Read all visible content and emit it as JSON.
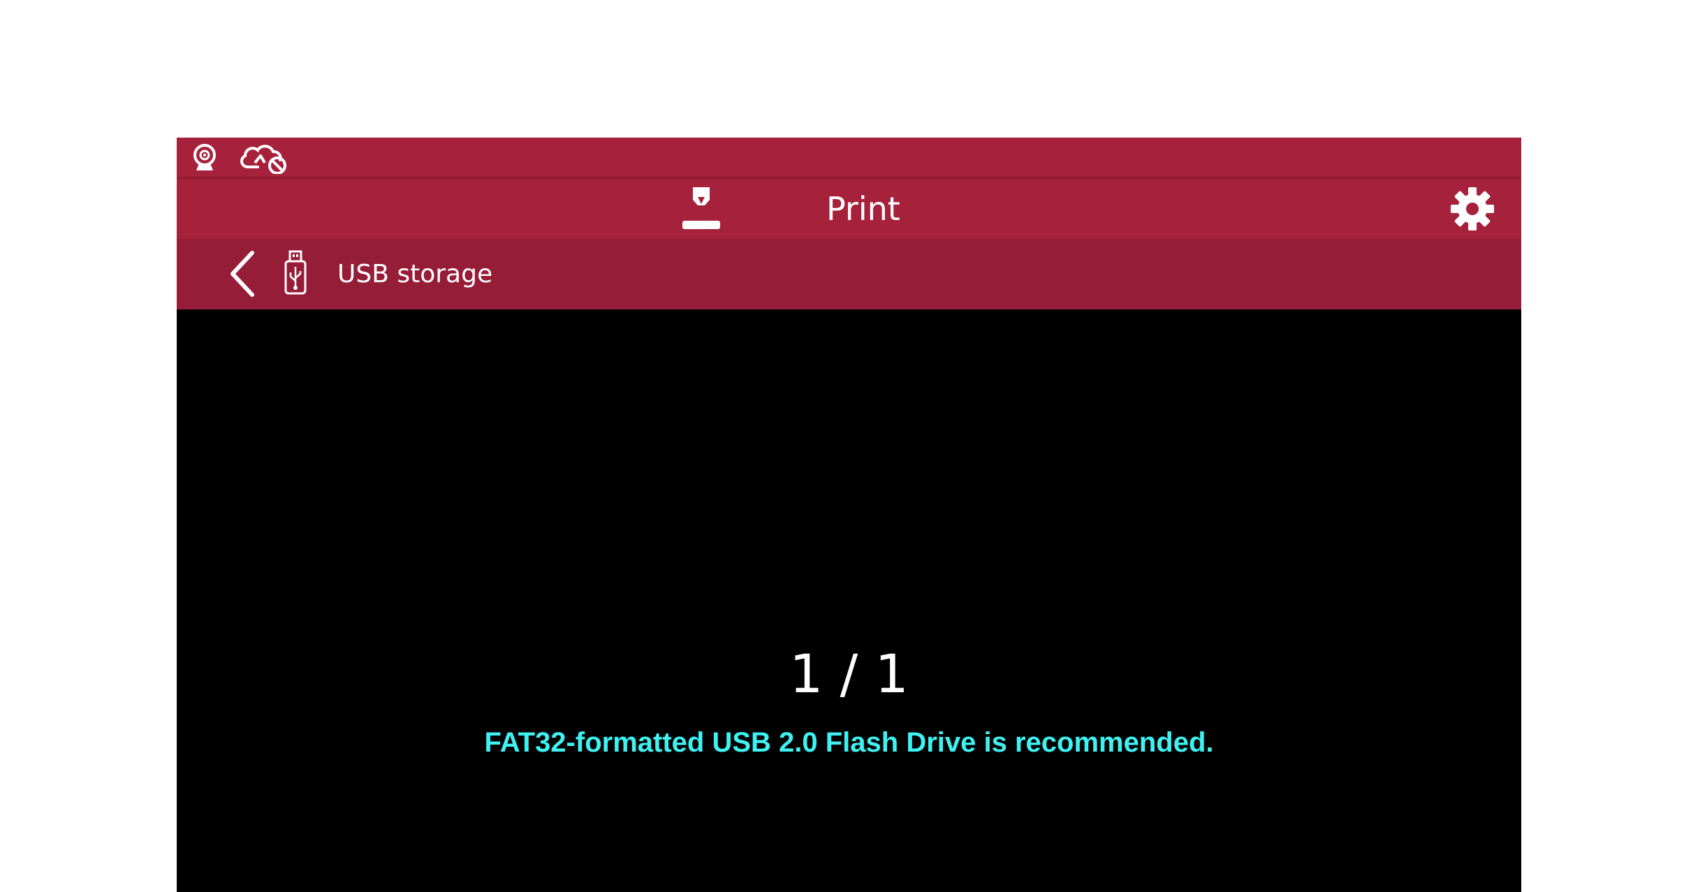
{
  "status_bar": {
    "icons": [
      "webcam-icon",
      "cloud-disconnected-icon"
    ],
    "background_color": "#a6213c"
  },
  "header": {
    "icon": "print-icon",
    "title": "Print",
    "settings_icon": "gear-icon",
    "background_color": "#a6213c"
  },
  "subheader": {
    "back_icon": "chevron-left-icon",
    "storage_icon": "usb-drive-icon",
    "title": "USB storage",
    "background_color": "#961d38"
  },
  "main": {
    "page_indicator": "1 / 1",
    "hint": "FAT32-formatted USB 2.0 Flash Drive is recommended.",
    "hint_color": "#3ff2f2"
  }
}
